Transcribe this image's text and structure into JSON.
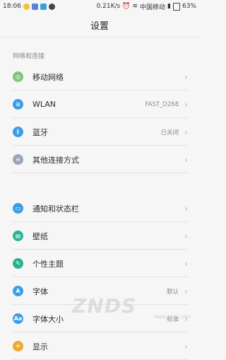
{
  "status_bar": {
    "time": "18:06",
    "speed": "0.21K/s",
    "carrier": "中国移动",
    "battery": "63%"
  },
  "title": "设置",
  "section_header": "网络和连接",
  "network_items": [
    {
      "label": "移动网络",
      "value": "",
      "icon": "mobile-network-icon",
      "color": "#7dc67b"
    },
    {
      "label": "WLAN",
      "value": "FAST_D268",
      "icon": "wifi-icon",
      "color": "#3a9ee6"
    },
    {
      "label": "蓝牙",
      "value": "已关闭",
      "icon": "bluetooth-icon",
      "color": "#3a9ee6"
    },
    {
      "label": "其他连接方式",
      "value": "",
      "icon": "link-icon",
      "color": "#9aa7b3"
    }
  ],
  "personal_items": [
    {
      "label": "通知和状态栏",
      "value": "",
      "icon": "notification-icon",
      "color": "#3a9ee6"
    },
    {
      "label": "壁纸",
      "value": "",
      "icon": "wallpaper-icon",
      "color": "#26b38f"
    },
    {
      "label": "个性主题",
      "value": "",
      "icon": "theme-icon",
      "color": "#26b38f"
    },
    {
      "label": "字体",
      "value": "默认",
      "icon": "font-icon",
      "color": "#3a9ee6"
    },
    {
      "label": "字体大小",
      "value": "标准",
      "icon": "font-size-icon",
      "color": "#3a9ee6"
    },
    {
      "label": "显示",
      "value": "",
      "icon": "display-icon",
      "color": "#f0a92a"
    }
  ],
  "watermark": {
    "text": "ZNDS",
    "url": "www.znds.com"
  }
}
